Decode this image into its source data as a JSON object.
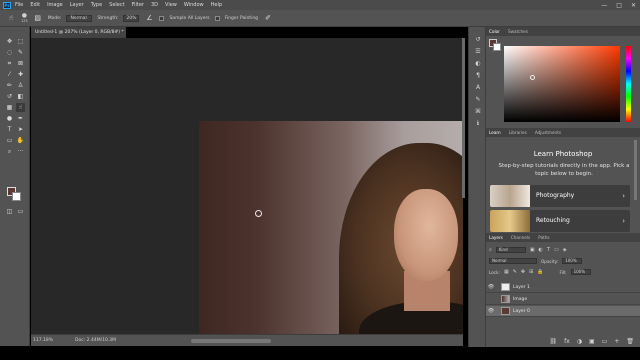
{
  "menubar": {
    "logo": "Ps",
    "items": [
      "File",
      "Edit",
      "Image",
      "Layer",
      "Type",
      "Select",
      "Filter",
      "3D",
      "View",
      "Window",
      "Help"
    ],
    "window_controls": [
      "—",
      "□",
      "✕"
    ]
  },
  "options_bar": {
    "brush_size": "125",
    "mode_label": "Mode:",
    "mode_value": "Normal",
    "strength_label": "Strength:",
    "strength_value": "20%",
    "sample_all_layers": "Sample All Layers",
    "finger_painting": "Finger Painting"
  },
  "document": {
    "tab_title": "Untitled-1 @ 207% (Layer 0, RGB/8#) *",
    "tab_close": "×",
    "zoom": "117.18%",
    "doc_info": "Doc: 2.44M/10.3M"
  },
  "toolbar": {
    "tools": [
      {
        "name": "move-tool-icon",
        "glyph": "✥"
      },
      {
        "name": "marquee-tool-icon",
        "glyph": "⬚"
      },
      {
        "name": "lasso-tool-icon",
        "glyph": "◌"
      },
      {
        "name": "quick-select-tool-icon",
        "glyph": "✎"
      },
      {
        "name": "crop-tool-icon",
        "glyph": "⌗"
      },
      {
        "name": "frame-tool-icon",
        "glyph": "⊠"
      },
      {
        "name": "eyedropper-tool-icon",
        "glyph": "⁄"
      },
      {
        "name": "healing-brush-tool-icon",
        "glyph": "✚"
      },
      {
        "name": "brush-tool-icon",
        "glyph": "✏"
      },
      {
        "name": "clone-stamp-tool-icon",
        "glyph": "♙"
      },
      {
        "name": "history-brush-tool-icon",
        "glyph": "↺"
      },
      {
        "name": "eraser-tool-icon",
        "glyph": "◧"
      },
      {
        "name": "gradient-tool-icon",
        "glyph": "▦"
      },
      {
        "name": "smudge-tool-icon",
        "glyph": "☝"
      },
      {
        "name": "dodge-tool-icon",
        "glyph": "●"
      },
      {
        "name": "pen-tool-icon",
        "glyph": "✒"
      },
      {
        "name": "type-tool-icon",
        "glyph": "T"
      },
      {
        "name": "path-select-tool-icon",
        "glyph": "➤"
      },
      {
        "name": "shape-tool-icon",
        "glyph": "▭"
      },
      {
        "name": "hand-tool-icon",
        "glyph": "✋"
      },
      {
        "name": "zoom-tool-icon",
        "glyph": "⌕"
      },
      {
        "name": "more-tools-icon",
        "glyph": "···"
      }
    ],
    "foreground_color": "#5a3a33",
    "background_color": "#ffffff"
  },
  "color_panel": {
    "tabs": [
      "Color",
      "Swatches"
    ],
    "hue_color": "#ff3a00"
  },
  "learn_panel": {
    "tabs": [
      "Learn",
      "Libraries",
      "Adjustments"
    ],
    "title": "Learn Photoshop",
    "description": "Step-by-step tutorials directly in the app. Pick a topic below to begin.",
    "cards": [
      {
        "label": "Photography",
        "arrow": "›"
      },
      {
        "label": "Retouching",
        "arrow": "›"
      }
    ]
  },
  "layers_panel": {
    "tabs": [
      "Layers",
      "Channels",
      "Paths"
    ],
    "filter_label": "Kind",
    "blend_mode": "Normal",
    "opacity_label": "Opacity:",
    "opacity_value": "100%",
    "lock_label": "Lock:",
    "fill_label": "Fill:",
    "fill_value": "100%",
    "layers": [
      {
        "name": "Layer 1",
        "visible": true,
        "selected": false
      },
      {
        "name": "Image",
        "visible": false,
        "selected": false
      },
      {
        "name": "Layer 0",
        "visible": true,
        "selected": true
      }
    ],
    "footer_icons": [
      "fx",
      "◑",
      "▣",
      "▭",
      "+",
      "🗑"
    ]
  },
  "dock": {
    "icons": [
      "history-icon",
      "properties-icon",
      "adjustments-icon",
      "paragraph-icon",
      "character-icon",
      "brush-settings-icon",
      "glyphs-icon",
      "info-icon"
    ]
  }
}
